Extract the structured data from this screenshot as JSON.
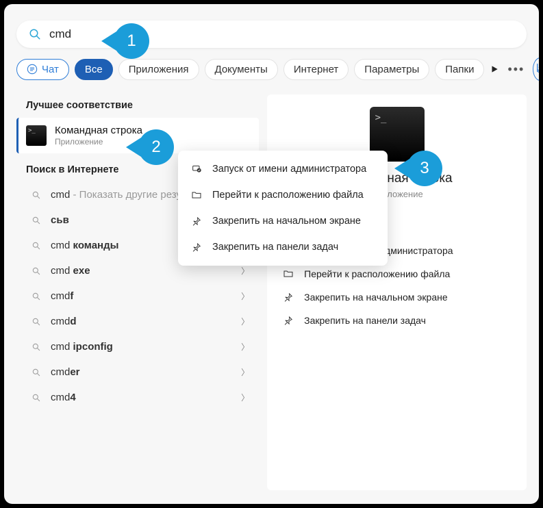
{
  "search": {
    "value": "cmd"
  },
  "filters": {
    "chat": "Чат",
    "tabs": [
      "Все",
      "Приложения",
      "Документы",
      "Интернет",
      "Параметры",
      "Папки"
    ],
    "active_index": 0
  },
  "sections": {
    "best_match": "Лучшее соответствие",
    "web_search": "Поиск в Интернете"
  },
  "best": {
    "title": "Командная строка",
    "subtitle": "Приложение"
  },
  "web_suggestions": [
    {
      "prefix": "cmd",
      "bold": "",
      "extra": " - Показать другие результаты поиска",
      "chev": false
    },
    {
      "prefix": "",
      "bold": "сьв",
      "extra": "",
      "chev": false
    },
    {
      "prefix": "cmd ",
      "bold": "команды",
      "extra": "",
      "chev": true
    },
    {
      "prefix": "cmd ",
      "bold": "exe",
      "extra": "",
      "chev": true
    },
    {
      "prefix": "cmd",
      "bold": "f",
      "extra": "",
      "chev": true
    },
    {
      "prefix": "cmd",
      "bold": "d",
      "extra": "",
      "chev": true
    },
    {
      "prefix": "cmd ",
      "bold": "ipconfig",
      "extra": "",
      "chev": true
    },
    {
      "prefix": "cmd",
      "bold": "er",
      "extra": "",
      "chev": true
    },
    {
      "prefix": "cmd",
      "bold": "4",
      "extra": "",
      "chev": true
    }
  ],
  "detail": {
    "title": "Командная строка",
    "subtitle": "Приложение"
  },
  "actions": [
    {
      "icon": "admin-icon",
      "label": "Запуск от имени администратора"
    },
    {
      "icon": "folder-icon",
      "label": "Перейти к расположению файла"
    },
    {
      "icon": "pin-icon",
      "label": "Закрепить на начальном экране"
    },
    {
      "icon": "pin-icon",
      "label": "Закрепить на панели задач"
    }
  ],
  "context_menu": [
    {
      "icon": "admin-icon",
      "label": "Запуск от имени администратора"
    },
    {
      "icon": "folder-icon",
      "label": "Перейти к расположению файла"
    },
    {
      "icon": "pin-icon",
      "label": "Закрепить на начальном экране"
    },
    {
      "icon": "pin-icon",
      "label": "Закрепить на панели задач"
    }
  ],
  "badges": {
    "b1": "1",
    "b2": "2",
    "b3": "3"
  }
}
